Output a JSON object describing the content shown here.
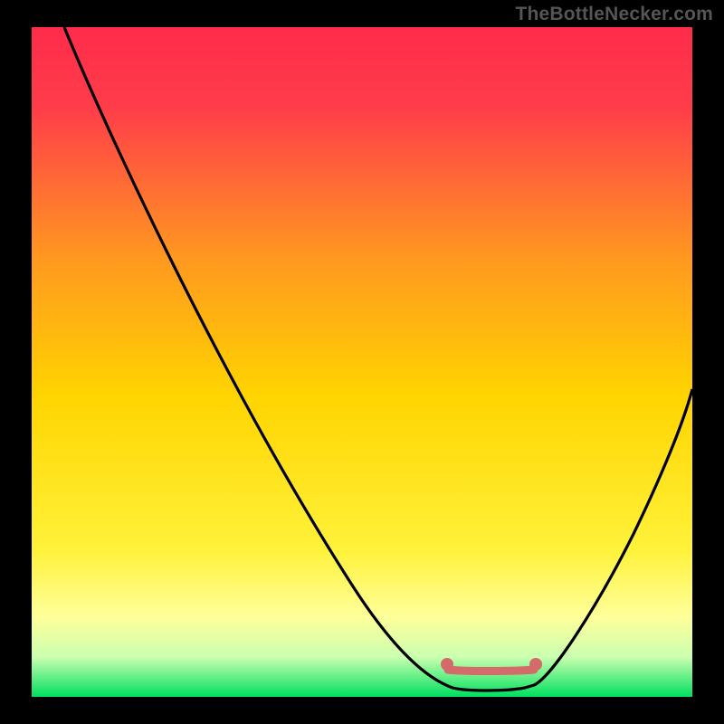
{
  "watermark": "TheBottleNecker.com",
  "colors": {
    "grad_top": "#ff2b4a",
    "grad_mid": "#ffd400",
    "grad_yellowpale": "#ffff80",
    "grad_green": "#00e060",
    "curve": "#000000",
    "dot": "#d46a6a",
    "frame": "#000000"
  },
  "chart_data": {
    "type": "line",
    "title": "",
    "xlabel": "",
    "ylabel": "",
    "xlim": [
      0,
      100
    ],
    "ylim": [
      0,
      100
    ],
    "x": [
      5,
      10,
      15,
      20,
      25,
      30,
      35,
      40,
      45,
      50,
      55,
      60,
      62,
      64,
      66,
      68,
      70,
      72,
      74,
      78,
      82,
      86,
      90,
      94,
      98,
      100
    ],
    "y": [
      100,
      92,
      84,
      76,
      68,
      60,
      52,
      44,
      36,
      28,
      20,
      10,
      6,
      3,
      1.5,
      0.8,
      0.5,
      0.5,
      0.8,
      3,
      9,
      17,
      26,
      35,
      45,
      50
    ],
    "flat_segment": {
      "x_start": 63,
      "x_end": 76,
      "y": 4
    },
    "annotation_dots": [
      {
        "x": 63,
        "y": 5
      },
      {
        "x": 76,
        "y": 5
      }
    ]
  }
}
